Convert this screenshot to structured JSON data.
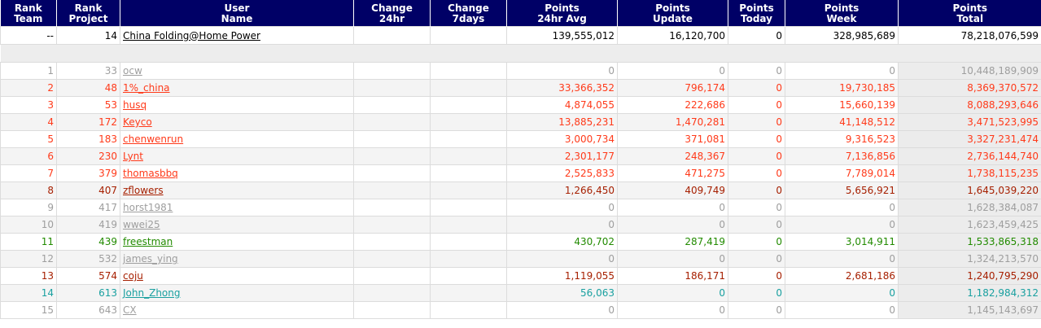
{
  "columns": [
    {
      "top": "Rank",
      "bottom": "Team"
    },
    {
      "top": "Rank",
      "bottom": "Project"
    },
    {
      "top": "User",
      "bottom": "Name"
    },
    {
      "top": "Change",
      "bottom": "24hr"
    },
    {
      "top": "Change",
      "bottom": "7days"
    },
    {
      "top": "Points",
      "bottom": "24hr Avg"
    },
    {
      "top": "Points",
      "bottom": "Update"
    },
    {
      "top": "Points",
      "bottom": "Today"
    },
    {
      "top": "Points",
      "bottom": "Week"
    },
    {
      "top": "Points",
      "bottom": "Total"
    }
  ],
  "team": {
    "rank_team": "--",
    "rank_project": "14",
    "name": "China Folding@Home Power",
    "change_24hr": "",
    "change_7days": "",
    "avg_24hr": "139,555,012",
    "update": "16,120,700",
    "today": "0",
    "week": "328,985,689",
    "total": "78,218,076,599"
  },
  "colors": {
    "header_bg": "#000066",
    "gray": "#9e9e9e",
    "red": "#ff3a1a",
    "dark": "#a61f00",
    "green": "#228b00",
    "teal": "#1aa0a0"
  },
  "members": [
    {
      "rank_team": "1",
      "rank_project": "33",
      "name": "ocw",
      "change_24hr": "",
      "change_7days": "",
      "avg_24hr": "0",
      "update": "0",
      "today": "0",
      "week": "0",
      "total": "10,448,189,909",
      "color": "gray"
    },
    {
      "rank_team": "2",
      "rank_project": "48",
      "name": "1%_china",
      "change_24hr": "",
      "change_7days": "",
      "avg_24hr": "33,366,352",
      "update": "796,174",
      "today": "0",
      "week": "19,730,185",
      "total": "8,369,370,572",
      "color": "red"
    },
    {
      "rank_team": "3",
      "rank_project": "53",
      "name": "husq",
      "change_24hr": "",
      "change_7days": "",
      "avg_24hr": "4,874,055",
      "update": "222,686",
      "today": "0",
      "week": "15,660,139",
      "total": "8,088,293,646",
      "color": "red"
    },
    {
      "rank_team": "4",
      "rank_project": "172",
      "name": "Keyco",
      "change_24hr": "",
      "change_7days": "",
      "avg_24hr": "13,885,231",
      "update": "1,470,281",
      "today": "0",
      "week": "41,148,512",
      "total": "3,471,523,995",
      "color": "red"
    },
    {
      "rank_team": "5",
      "rank_project": "183",
      "name": "chenwenrun",
      "change_24hr": "",
      "change_7days": "",
      "avg_24hr": "3,000,734",
      "update": "371,081",
      "today": "0",
      "week": "9,316,523",
      "total": "3,327,231,474",
      "color": "red"
    },
    {
      "rank_team": "6",
      "rank_project": "230",
      "name": "Lynt",
      "change_24hr": "",
      "change_7days": "",
      "avg_24hr": "2,301,177",
      "update": "248,367",
      "today": "0",
      "week": "7,136,856",
      "total": "2,736,144,740",
      "color": "red"
    },
    {
      "rank_team": "7",
      "rank_project": "379",
      "name": "thomasbbq",
      "change_24hr": "",
      "change_7days": "",
      "avg_24hr": "2,525,833",
      "update": "471,275",
      "today": "0",
      "week": "7,789,014",
      "total": "1,738,115,235",
      "color": "red"
    },
    {
      "rank_team": "8",
      "rank_project": "407",
      "name": "zflowers",
      "change_24hr": "",
      "change_7days": "",
      "avg_24hr": "1,266,450",
      "update": "409,749",
      "today": "0",
      "week": "5,656,921",
      "total": "1,645,039,220",
      "color": "dark"
    },
    {
      "rank_team": "9",
      "rank_project": "417",
      "name": "horst1981",
      "change_24hr": "",
      "change_7days": "",
      "avg_24hr": "0",
      "update": "0",
      "today": "0",
      "week": "0",
      "total": "1,628,384,087",
      "color": "gray"
    },
    {
      "rank_team": "10",
      "rank_project": "419",
      "name": "wwei25",
      "change_24hr": "",
      "change_7days": "",
      "avg_24hr": "0",
      "update": "0",
      "today": "0",
      "week": "0",
      "total": "1,623,459,425",
      "color": "gray"
    },
    {
      "rank_team": "11",
      "rank_project": "439",
      "name": "freestman",
      "change_24hr": "",
      "change_7days": "",
      "avg_24hr": "430,702",
      "update": "287,419",
      "today": "0",
      "week": "3,014,911",
      "total": "1,533,865,318",
      "color": "green"
    },
    {
      "rank_team": "12",
      "rank_project": "532",
      "name": "james_ying",
      "change_24hr": "",
      "change_7days": "",
      "avg_24hr": "0",
      "update": "0",
      "today": "0",
      "week": "0",
      "total": "1,324,213,570",
      "color": "gray"
    },
    {
      "rank_team": "13",
      "rank_project": "574",
      "name": "coju",
      "change_24hr": "",
      "change_7days": "",
      "avg_24hr": "1,119,055",
      "update": "186,171",
      "today": "0",
      "week": "2,681,186",
      "total": "1,240,795,290",
      "color": "dark"
    },
    {
      "rank_team": "14",
      "rank_project": "613",
      "name": "John_Zhong",
      "change_24hr": "",
      "change_7days": "",
      "avg_24hr": "56,063",
      "update": "0",
      "today": "0",
      "week": "0",
      "total": "1,182,984,312",
      "color": "teal"
    },
    {
      "rank_team": "15",
      "rank_project": "643",
      "name": "CX",
      "change_24hr": "",
      "change_7days": "",
      "avg_24hr": "0",
      "update": "0",
      "today": "0",
      "week": "0",
      "total": "1,145,143,697",
      "color": "gray"
    }
  ]
}
